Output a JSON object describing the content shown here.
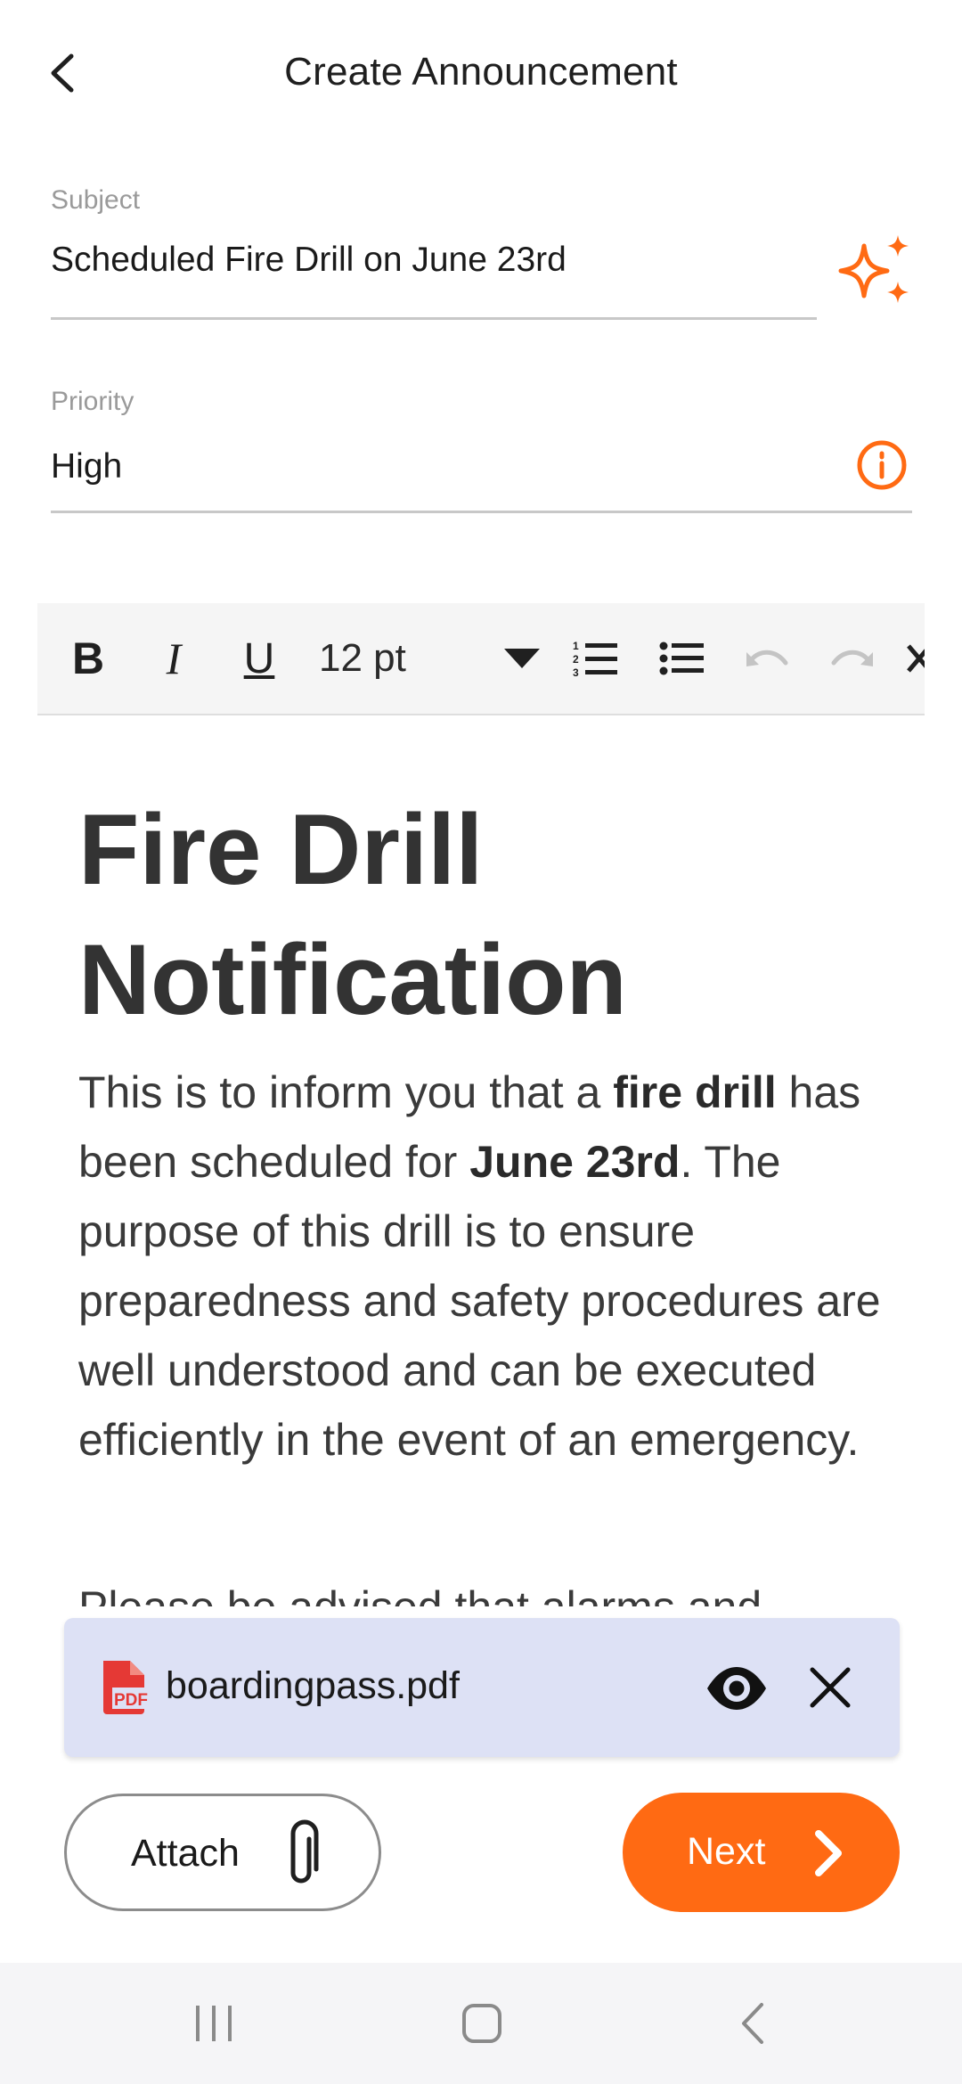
{
  "header": {
    "title": "Create Announcement"
  },
  "subject": {
    "label": "Subject",
    "value": "Scheduled Fire Drill on June 23rd"
  },
  "priority": {
    "label": "Priority",
    "value": "High"
  },
  "toolbar": {
    "bold": "B",
    "italic": "I",
    "underline": "U",
    "font_size": "12 pt",
    "icons": [
      "numbered-list-icon",
      "bullet-list-icon",
      "undo-icon",
      "redo-icon",
      "clear-format-icon"
    ]
  },
  "content": {
    "heading": "Fire Drill Notification",
    "para1": {
      "t1": "This is to inform you that a ",
      "b1": "fire drill",
      "t2": " has been scheduled for ",
      "b2": "June 23rd",
      "t3": ". The purpose of this drill is to ensure preparedness and safety procedures are well understood and can be executed efficiently in the event of an emergency."
    },
    "para2_partial": "Please be advised that alarms and"
  },
  "attachment": {
    "filename": "boardingpass.pdf",
    "type_label": "PDF"
  },
  "actions": {
    "attach_label": "Attach",
    "next_label": "Next"
  },
  "colors": {
    "accent": "#ff6a13",
    "attachment_bg": "#dde1f5",
    "pdf_red": "#e53935",
    "disabled": "#c4c4c4"
  }
}
